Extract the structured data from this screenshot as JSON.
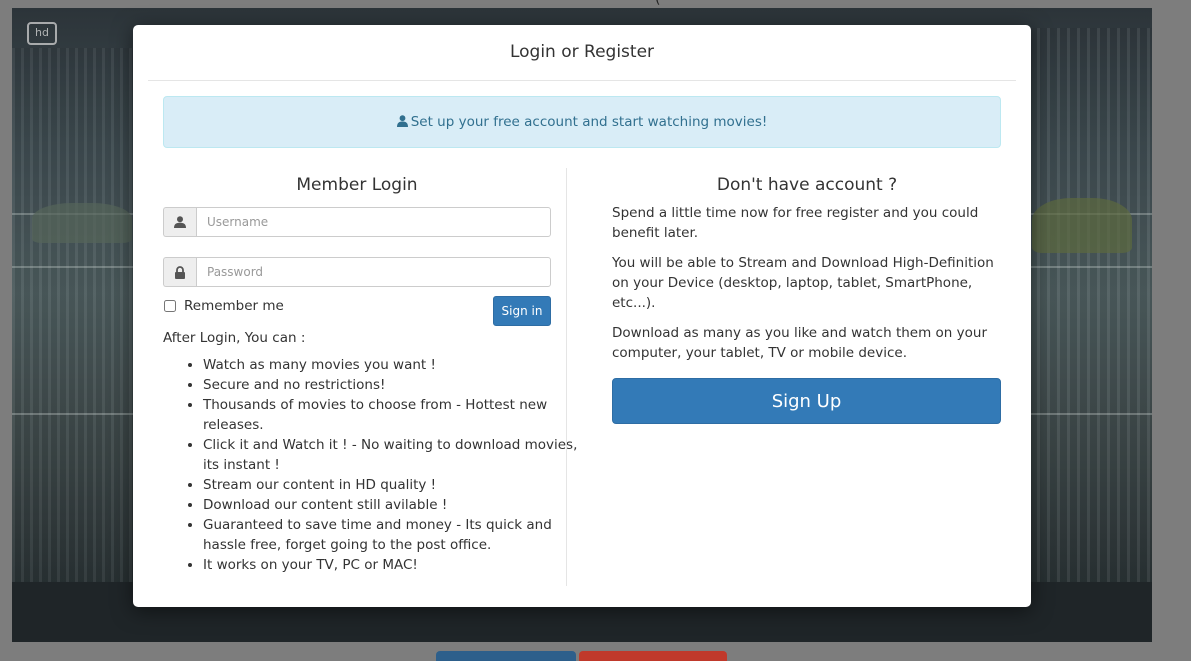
{
  "background": {
    "hd_badge": "hd",
    "title_fragment": "(",
    "accent_blue": "#337ab7",
    "accent_red": "#c0392b"
  },
  "modal": {
    "title": "Login or Register",
    "alert": {
      "icon": "user-icon",
      "text": "Set up your free account and start watching movies!"
    },
    "login": {
      "heading": "Member Login",
      "username_placeholder": "Username",
      "password_placeholder": "Password",
      "username_icon": "user-icon",
      "password_icon": "lock-icon",
      "remember_label": "Remember me",
      "signin_label": "Sign in",
      "after_login_heading": "After Login, You can :",
      "benefits": [
        "Watch as many movies you want !",
        "Secure and no restrictions!",
        "Thousands of movies to choose from - Hottest new releases.",
        "Click it and Watch it ! - No waiting to download movies, its instant !",
        "Stream our content in HD quality !",
        "Download our content still avilable !",
        "Guaranteed to save time and money - Its quick and hassle free, forget going to the post office.",
        "It works on your TV, PC or MAC!"
      ]
    },
    "register": {
      "heading": "Don't have account ?",
      "paragraphs": [
        "Spend a little time now for free register and you could benefit later.",
        "You will be able to Stream and Download High-Definition on your Device (desktop, laptop, tablet, SmartPhone, etc...).",
        "Download as many as you like and watch them on your computer, your tablet, TV or mobile device."
      ],
      "signup_label": "Sign Up"
    }
  }
}
